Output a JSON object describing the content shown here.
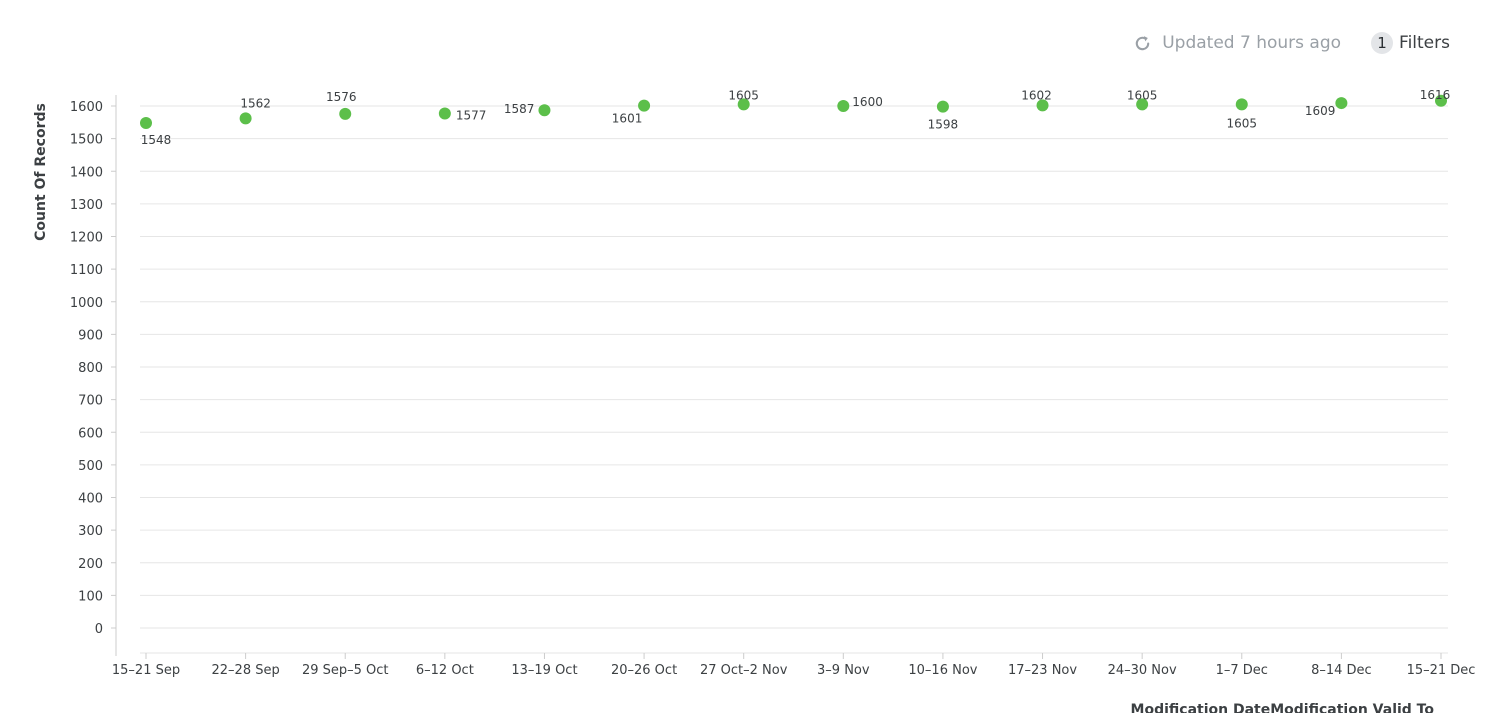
{
  "toolbar": {
    "refresh_icon": "refresh-icon",
    "updated_text": "Updated 7 hours ago",
    "filters_count": "1",
    "filters_label": "Filters"
  },
  "colors": {
    "point": "#5cbf4a",
    "grid": "#e6e6e6",
    "axis": "#cccccc",
    "text": "#3c4043"
  },
  "chart_data": {
    "type": "scatter",
    "categories": [
      "15–21 Sep",
      "22–28 Sep",
      "29 Sep–5 Oct",
      "6–12 Oct",
      "13–19 Oct",
      "20–26 Oct",
      "27 Oct–2 Nov",
      "3–9 Nov",
      "10–16 Nov",
      "17–23 Nov",
      "24–30 Nov",
      "1–7 Dec",
      "8–14 Dec",
      "15–21 Dec"
    ],
    "values": [
      1548,
      1562,
      1576,
      1577,
      1587,
      1601,
      1605,
      1600,
      1598,
      1602,
      1605,
      1605,
      1609,
      1616
    ],
    "data_labels": [
      "1548",
      "1562",
      "1576",
      "1577",
      "1587",
      "1601",
      "1605",
      "1600",
      "1598",
      "1602",
      "1605",
      "1605",
      "1609",
      "1616"
    ],
    "ylabel": "Count Of Records",
    "xlabel": "Modification DateModification Valid To",
    "ylim": [
      0,
      1600
    ],
    "yticks": [
      0,
      100,
      200,
      300,
      400,
      500,
      600,
      700,
      800,
      900,
      1000,
      1100,
      1200,
      1300,
      1400,
      1500,
      1600
    ],
    "grid": true,
    "legend": "none"
  }
}
